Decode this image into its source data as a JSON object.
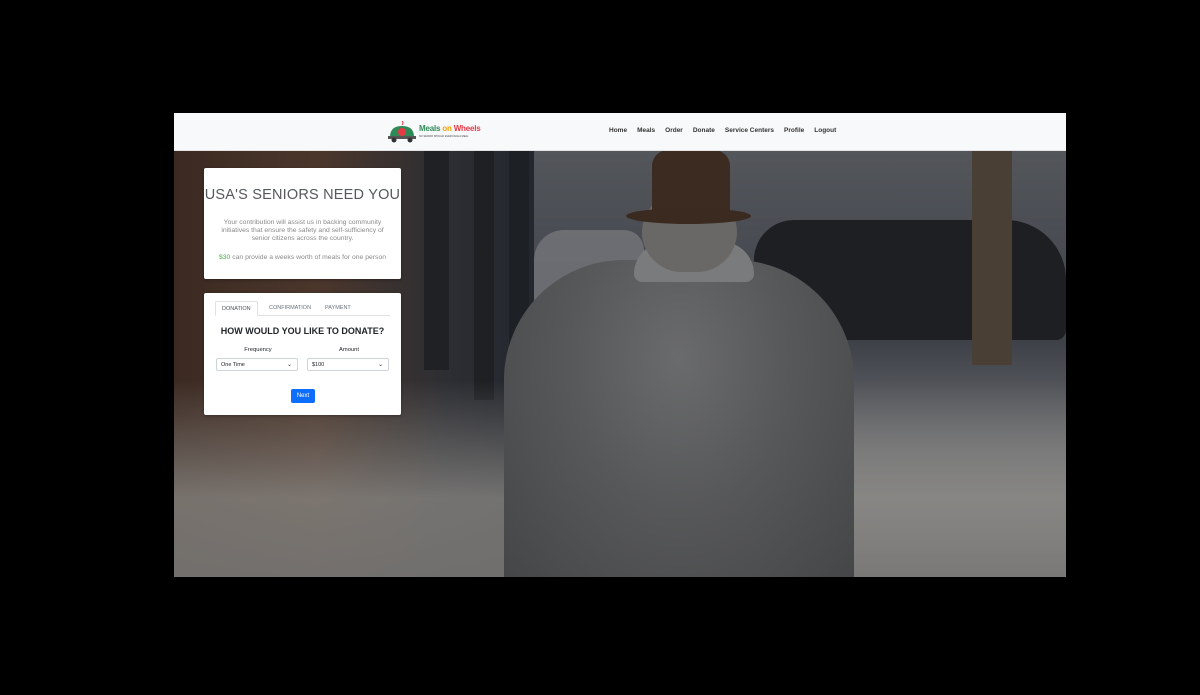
{
  "brand": {
    "name_part1": "Meals",
    "name_part2": "on",
    "name_part3": "Wheels",
    "tagline": "NO SENIOR SHOULD EVER FACE A MEAL"
  },
  "nav": {
    "items": [
      "Home",
      "Meals",
      "Order",
      "Donate",
      "Service Centers",
      "Profile",
      "Logout"
    ]
  },
  "hero_card": {
    "title": "USA'S SENIORS NEED YOU",
    "text": "Your contribution will assist us in backing community initiatives that ensure the safety and self-sufficiency of senior citizens across the country.",
    "stat_amount": "$30",
    "stat_text": " can provide a weeks worth of meals for one person"
  },
  "donate_form": {
    "tabs": [
      "DONATION",
      "CONFIRMATION",
      "PAYMENT"
    ],
    "active_tab": "DONATION",
    "heading": "HOW WOULD YOU LIKE TO DONATE?",
    "frequency_label": "Frequency",
    "frequency_value": "One Time",
    "amount_label": "Amount",
    "amount_value": "$100",
    "next_label": "Next"
  },
  "colors": {
    "accent": "#0d6efd",
    "money": "#4cae4c",
    "brand_green": "#2e8b57"
  }
}
